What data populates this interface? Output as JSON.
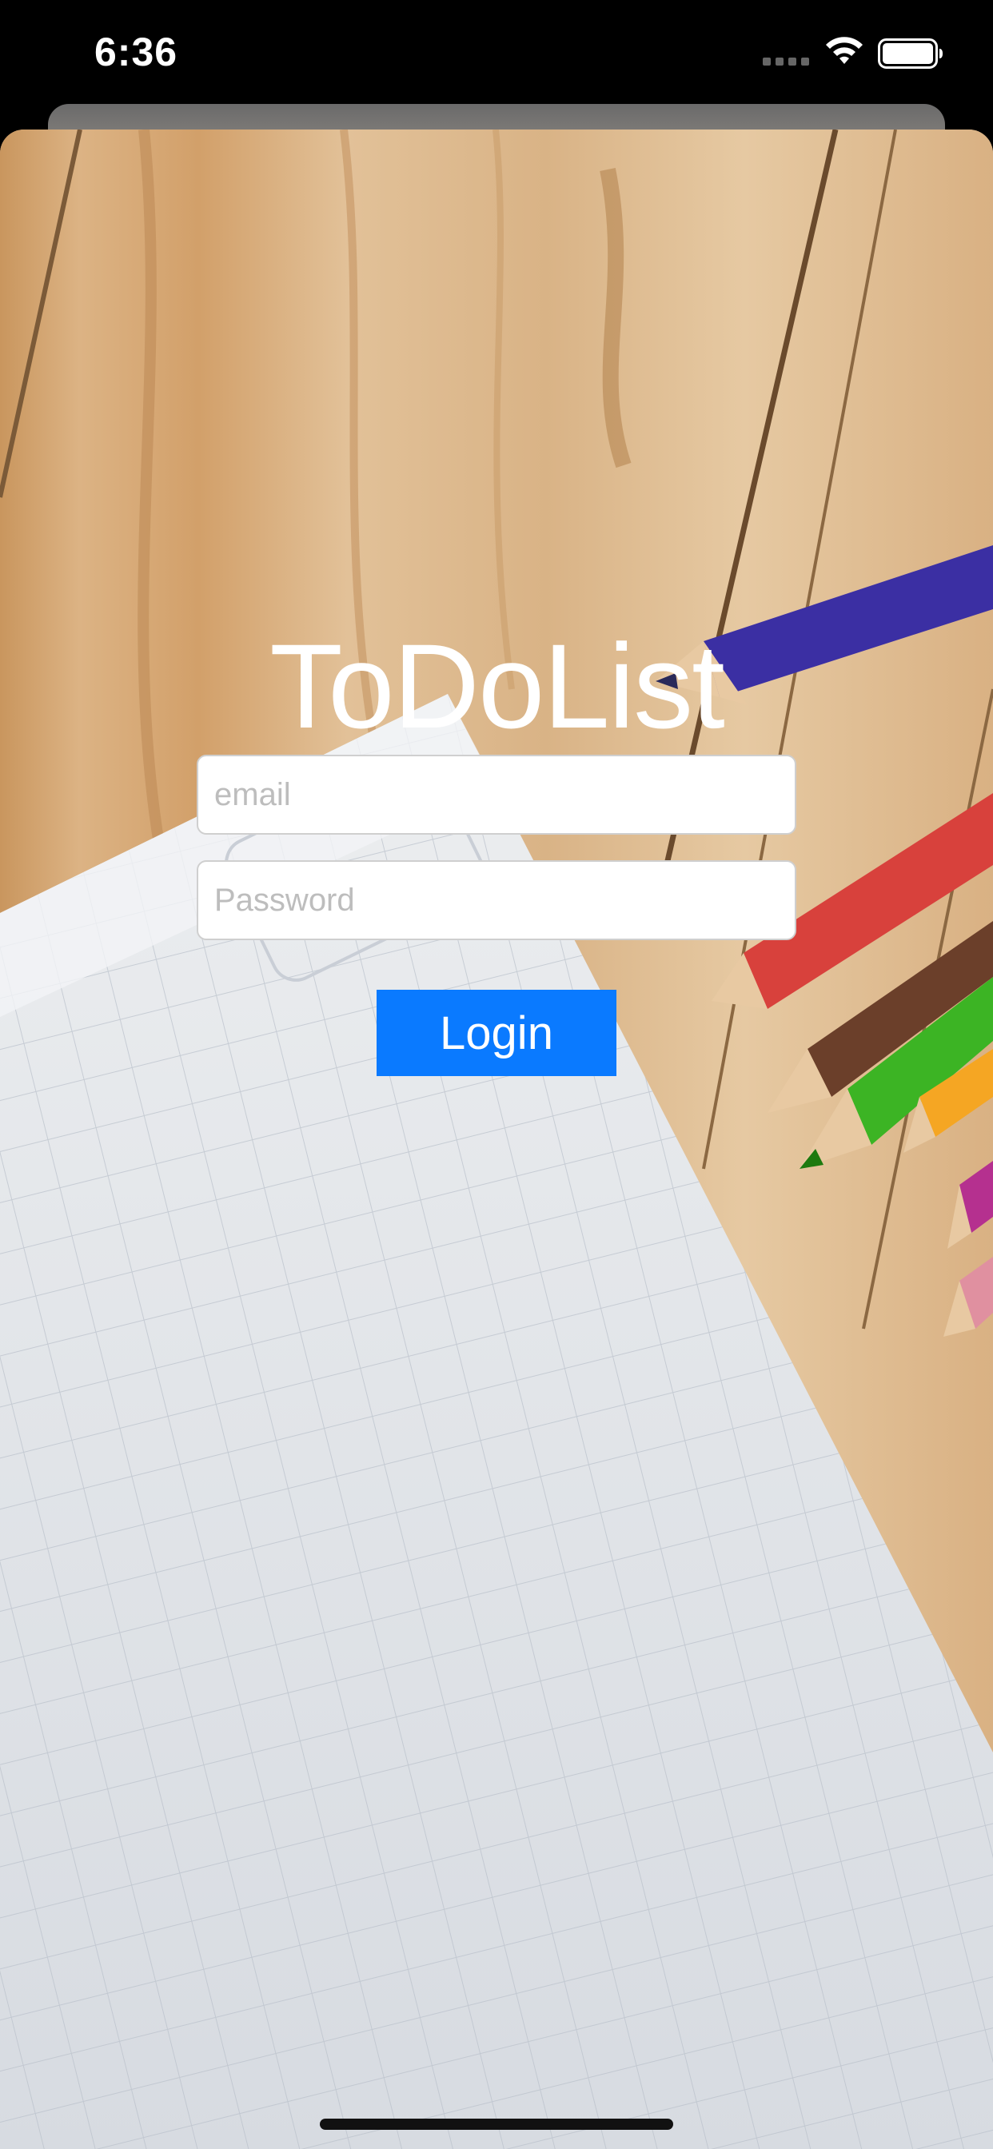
{
  "status_bar": {
    "time": "6:36",
    "icons": [
      "signal-icon",
      "wifi-icon",
      "battery-icon"
    ]
  },
  "app": {
    "title": "ToDoList"
  },
  "login_form": {
    "email_placeholder": "email",
    "email_value": "",
    "password_placeholder": "Password",
    "password_value": "",
    "login_label": "Login"
  },
  "colors": {
    "login_button": "#0a7aff",
    "title_text": "#ffffff",
    "status_bar_bg": "#000000"
  }
}
